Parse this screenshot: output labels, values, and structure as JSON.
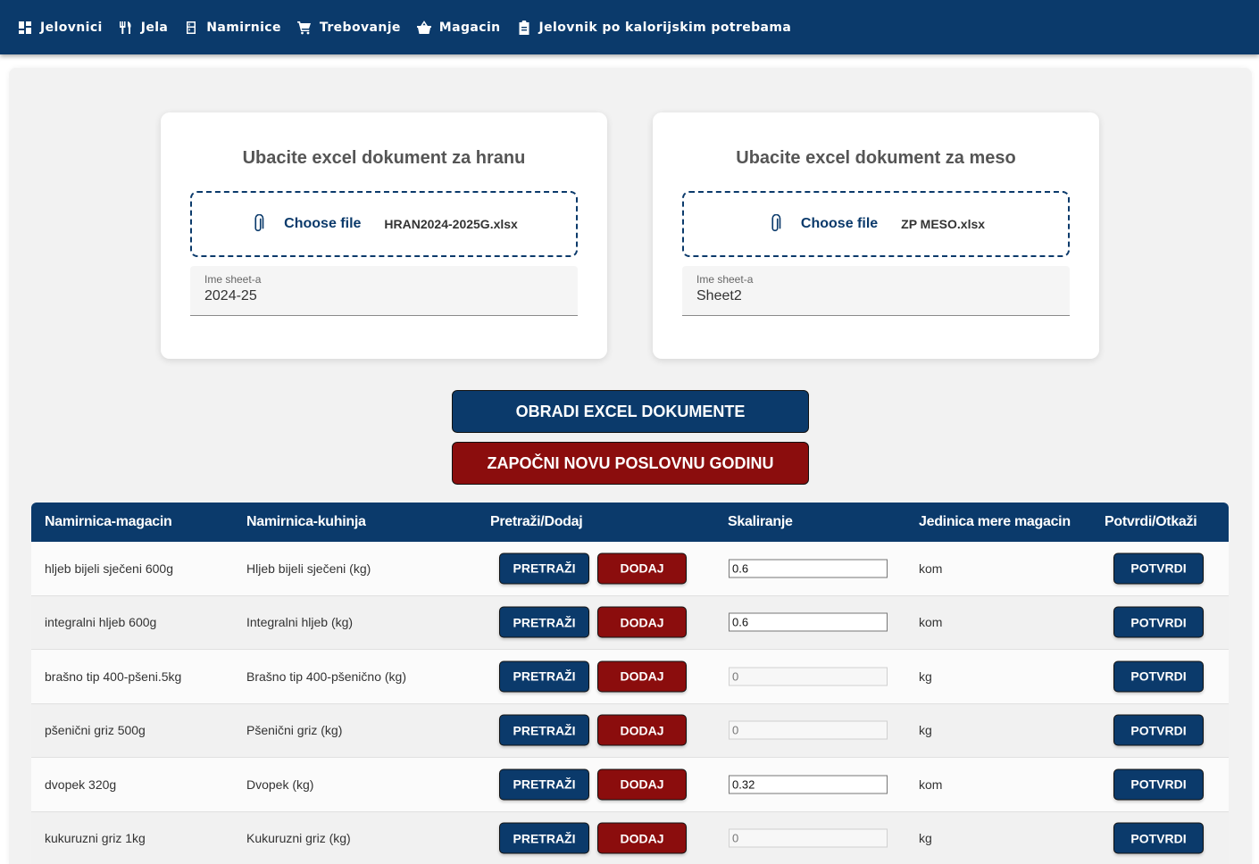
{
  "nav": {
    "items": [
      {
        "label": "Jelovnici",
        "icon": "dashboard-icon"
      },
      {
        "label": "Jela",
        "icon": "utensils-icon"
      },
      {
        "label": "Namirnice",
        "icon": "fridge-icon"
      },
      {
        "label": "Trebovanje",
        "icon": "cart-icon"
      },
      {
        "label": "Magacin",
        "icon": "basket-icon"
      },
      {
        "label": "Jelovnik po kalorijskim potrebama",
        "icon": "clipboard-icon"
      }
    ]
  },
  "upload": {
    "food": {
      "title": "Ubacite excel dokument za hranu",
      "choose_label": "Choose file",
      "file_name": "HRAN2024-2025G.xlsx",
      "sheet_label": "Ime sheet-a",
      "sheet_value": "2024-25"
    },
    "meat": {
      "title": "Ubacite excel dokument za meso",
      "choose_label": "Choose file",
      "file_name": "ZP MESO.xlsx",
      "sheet_label": "Ime sheet-a",
      "sheet_value": "Sheet2"
    }
  },
  "actions": {
    "process_label": "OBRADI EXCEL DOKUMENTE",
    "new_year_label": "ZAPOČNI NOVU POSLOVNU GODINU"
  },
  "colors": {
    "primary": "#0b3a6b",
    "danger": "#8b0d0d"
  },
  "table": {
    "headers": [
      "Namirnica-magacin",
      "Namirnica-kuhinja",
      "Pretraži/Dodaj",
      "Skaliranje",
      "Jedinica mere magacin",
      "Potvrdi/Otkaži"
    ],
    "search_label": "PRETRAŽI",
    "add_label": "DODAJ",
    "confirm_label": "POTVRDI",
    "rows": [
      {
        "magacin": "hljeb bijeli sječeni 600g",
        "kuhinja": "Hljeb bijeli sječeni (kg)",
        "scale": "0.6",
        "unit": "kom",
        "enabled": true
      },
      {
        "magacin": "integralni hljeb 600g",
        "kuhinja": "Integralni hljeb (kg)",
        "scale": "0.6",
        "unit": "kom",
        "enabled": true
      },
      {
        "magacin": "brašno tip 400-pšeni.5kg",
        "kuhinja": "Brašno tip 400-pšenično (kg)",
        "scale": "0",
        "unit": "kg",
        "enabled": false
      },
      {
        "magacin": "pšenični griz 500g",
        "kuhinja": "Pšenični griz (kg)",
        "scale": "0",
        "unit": "kg",
        "enabled": false
      },
      {
        "magacin": "dvopek 320g",
        "kuhinja": "Dvopek (kg)",
        "scale": "0.32",
        "unit": "kom",
        "enabled": true
      },
      {
        "magacin": "kukuruzni griz 1kg",
        "kuhinja": "Kukuruzni griz (kg)",
        "scale": "0",
        "unit": "kg",
        "enabled": false
      }
    ]
  }
}
